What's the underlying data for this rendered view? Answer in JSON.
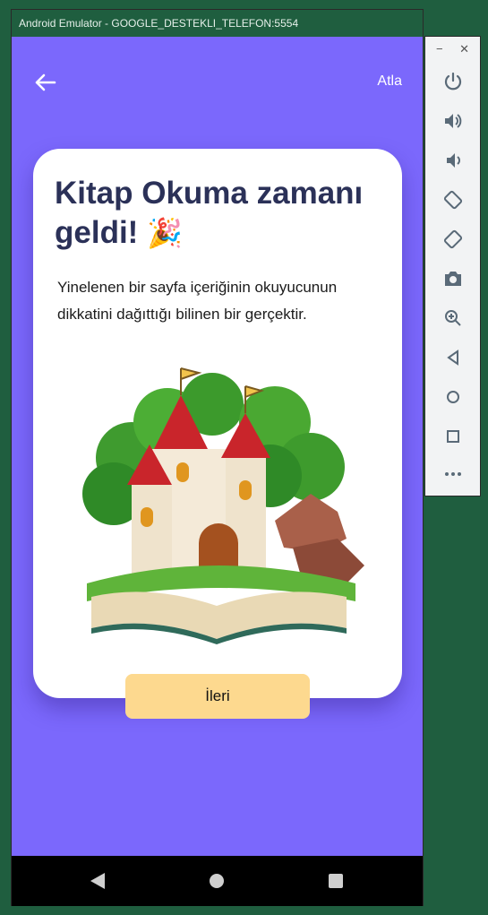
{
  "window": {
    "title": "Android Emulator - GOOGLE_DESTEKLI_TELEFON:5554"
  },
  "app": {
    "skip_label": "Atla",
    "card": {
      "title": "Kitap Okuma zamanı geldi!",
      "emoji": "🎉",
      "body": "Yinelenen bir sayfa içeriğinin okuyucunun dikkatini dağıttığı bilinen bir gerçektir."
    },
    "next_label": "İleri"
  },
  "colors": {
    "background": "#7b68fc",
    "title": "#2b3158",
    "button": "#fdd98f"
  },
  "toolbar": {
    "items": [
      "power-icon",
      "volume-up-icon",
      "volume-down-icon",
      "rotate-left-icon",
      "rotate-right-icon",
      "camera-icon",
      "zoom-icon",
      "back-icon",
      "home-icon",
      "overview-icon",
      "more-icon"
    ]
  }
}
